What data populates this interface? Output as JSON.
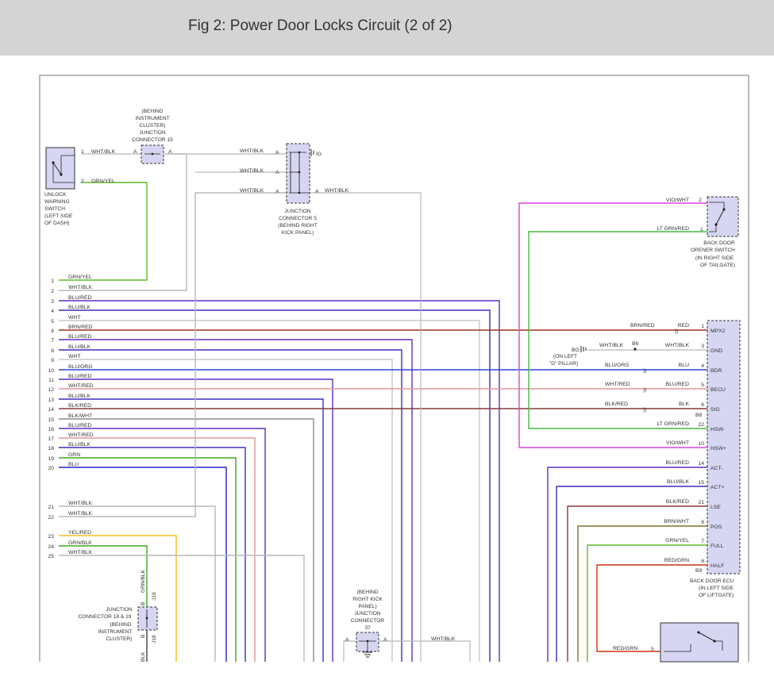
{
  "figure": {
    "title": "Fig 2: Power Door Locks Circuit (2 of 2)"
  },
  "colors": {
    "GRN/YEL": "#5dbb2a",
    "WHT/BLK": "#b8b8b8",
    "BLU/RED": "#5a2fc8",
    "BLU/BLK": "#3a2fc0",
    "WHT": "#c8c8c8",
    "BRN/RED": "#a0301c",
    "BLU": "#2222cc",
    "BLU/ORG": "#3344dd",
    "WHT/RED": "#e09898",
    "BLK/RED": "#8a3a3a",
    "BLK/WHT": "#8c8c8c",
    "GRN": "#3aa81c",
    "YEL/RED": "#f0c020",
    "GRN/BLK": "#3aa81c",
    "VIO/WHT": "#e040e0",
    "LT GRN/RED": "#44bb44",
    "BRN/WHT": "#807030",
    "RED/GRN": "#d03010",
    "RED": "#c01010",
    "BLK": "#222222"
  },
  "left_wires": [
    {
      "pin": "1",
      "color": "GRN/YEL"
    },
    {
      "pin": "2",
      "color": "WHT/BLK"
    },
    {
      "pin": "3",
      "color": "BLU/RED"
    },
    {
      "pin": "4",
      "color": "BLU/BLK"
    },
    {
      "pin": "5",
      "color": "WHT"
    },
    {
      "pin": "6",
      "color": "BRN/RED"
    },
    {
      "pin": "7",
      "color": "BLU/RED"
    },
    {
      "pin": "8",
      "color": "BLU/BLK"
    },
    {
      "pin": "9",
      "color": "WHT"
    },
    {
      "pin": "10",
      "color": "BLU/ORG"
    },
    {
      "pin": "11",
      "color": "BLU/RED"
    },
    {
      "pin": "12",
      "color": "WHT/RED"
    },
    {
      "pin": "13",
      "color": "BLU/BLK"
    },
    {
      "pin": "14",
      "color": "BLK/RED"
    },
    {
      "pin": "15",
      "color": "BLK/WHT"
    },
    {
      "pin": "16",
      "color": "BLU/RED"
    },
    {
      "pin": "17",
      "color": "WHT/RED"
    },
    {
      "pin": "18",
      "color": "BLU/BLK"
    },
    {
      "pin": "19",
      "color": "GRN"
    },
    {
      "pin": "20",
      "color": "BLU"
    },
    {
      "pin": "21",
      "color": "WHT/BLK"
    },
    {
      "pin": "22",
      "color": "WHT/BLK"
    },
    {
      "pin": "23",
      "color": "YEL/RED"
    },
    {
      "pin": "24",
      "color": "GRN/BLK"
    },
    {
      "pin": "25",
      "color": "WHT/BLK"
    }
  ],
  "unlock_switch": {
    "label": [
      "UNLOCK",
      "WARNING",
      "SWITCH",
      "(LEFT SIDE",
      "OF DASH)"
    ],
    "pin1": "1",
    "pin1_wire": "WHT/BLK",
    "pin2": "2",
    "pin2_wire": "GRN/YEL"
  },
  "jc15": {
    "label": [
      "(BEHIND",
      "INSTRUMENT",
      "CLUSTER)",
      "JUNCTION",
      "CONNECTOR 15"
    ],
    "pin_a": "A"
  },
  "jc5": {
    "label": [
      "JUNCTION",
      "CONNECTOR 5",
      "(BEHIND RIGHT",
      "KICK PANEL)"
    ],
    "ig": "IG",
    "wire1": "WHT/BLK",
    "wire2": "WHT/BLK",
    "wire3": "WHT/BLK",
    "wire_out": "WHT/BLK",
    "pin_a": "A"
  },
  "back_door_opener": {
    "label": [
      "BACK DOOR",
      "OPENER SWITCH",
      "(IN RIGHT SIDE",
      "OF TAILGATE)"
    ],
    "pin2": "2",
    "wire2": "VIO/WHT",
    "pin1": "1",
    "wire1": "LT GRN/RED"
  },
  "ecu": {
    "label": [
      "BACK DOOR ECU",
      "(IN LEFT SIDE",
      "OF LIFTGATE)"
    ],
    "ground_label": "BO",
    "ground_loc": [
      "(ON LEFT",
      "\"D\" PILLAR)"
    ],
    "b6": "B6",
    "b8": "B8",
    "b9": "B9",
    "pins": [
      {
        "pin": "1",
        "name": "MPX2",
        "wire_in": "BRN/RED",
        "wire_out": "RED"
      },
      {
        "pin": "3",
        "name": "GND",
        "wire_in": "WHT/BLK",
        "wire_out": "WHT/BLK"
      },
      {
        "pin": "4",
        "name": "BDR",
        "wire_in": "BLU/ORG",
        "wire_out": "BLU"
      },
      {
        "pin": "5",
        "name": "BECU",
        "wire_in": "WHT/RED",
        "wire_out": "BLU/RED"
      },
      {
        "pin": "6",
        "name": "SIG",
        "wire_in": "BLK/RED",
        "wire_out": "BLK"
      },
      {
        "pin": "22",
        "name": "HSW-",
        "wire_out": "LT GRN/RED"
      },
      {
        "pin": "10",
        "name": "HSW+",
        "wire_out": "VIO/WHT"
      },
      {
        "pin": "14",
        "name": "ACT-",
        "wire_out": "BLU/RED"
      },
      {
        "pin": "15",
        "name": "ACT+",
        "wire_out": "BLU/BLK"
      },
      {
        "pin": "21",
        "name": "LSE",
        "wire_out": "BLK/RED"
      },
      {
        "pin": "8",
        "name": "POS",
        "wire_out": "BRN/WHT"
      },
      {
        "pin": "7",
        "name": "FULL",
        "wire_out": "GRN/YEL"
      },
      {
        "pin": "6",
        "name": "HALF",
        "wire_out": "RED/GRN"
      }
    ]
  },
  "jc18": {
    "label": [
      "JUNCTION",
      "CONNECTOR 18 & 19",
      "(BEHIND",
      "INSTRUMENT",
      "CLUSTER)"
    ],
    "top_wire": "GRN/BLK",
    "top_pin": "J19",
    "bottom_pin": "J18",
    "pin_b_top": "B",
    "pin_b_bot": "B",
    "bottom_wire": "BLK"
  },
  "jc37": {
    "label": [
      "(BEHIND",
      "RIGHT KICK",
      "PANEL)",
      "JUNCTION",
      "CONNECTOR",
      "37"
    ],
    "pin_a": "A",
    "wire": "WHT/BLK"
  },
  "bottom_switch": {
    "pin": "5",
    "wire": "RED/GRN"
  }
}
